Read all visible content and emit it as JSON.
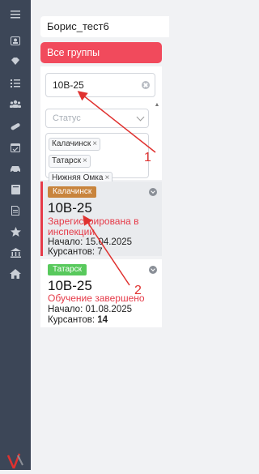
{
  "sidebar": {
    "icons": [
      "menu-icon",
      "profile-card-icon",
      "gem-icon",
      "checklist-icon",
      "people-group-icon",
      "pills-icon",
      "calendar-check-icon",
      "car-icon",
      "book-icon",
      "document-icon",
      "star-icon",
      "bank-icon",
      "home-icon"
    ],
    "logo": "stylized-logo-icon"
  },
  "header": {
    "user_name": "Борис_тест6"
  },
  "all_groups_button": "Все группы",
  "filters": {
    "search_value": "10В-25",
    "status_placeholder": "Статус",
    "selected_cities": [
      "Калачинск",
      "Татарск",
      "Нижняя Омка"
    ]
  },
  "groups": [
    {
      "city": "Калачинск",
      "city_color": "#c8843d",
      "name": "10В-25",
      "status": "Зарегистрирована в инспекции",
      "start_label": "Начало: 15.04.2025",
      "cadets_label": "Курсантов: 7"
    },
    {
      "city": "Татарск",
      "city_color": "#58c95c",
      "name": "10В-25",
      "status": "Обучение завершено",
      "start_label": "Начало: 01.08.2025",
      "cadets_label": "Курсантов:",
      "cadets_count": "14"
    }
  ],
  "annotations": {
    "labels": [
      "1",
      "2"
    ],
    "color": "#e0312f"
  }
}
